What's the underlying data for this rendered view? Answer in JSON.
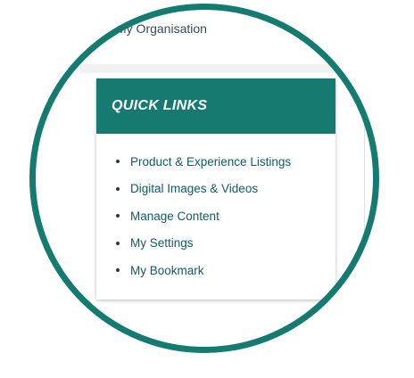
{
  "header": {
    "organisation_label": "My Organisation"
  },
  "quick_links": {
    "title": "QUICK LINKS",
    "items": [
      {
        "label": "Product & Experience Listings"
      },
      {
        "label": "Digital Images & Videos"
      },
      {
        "label": "Manage Content"
      },
      {
        "label": "My Settings"
      },
      {
        "label": "My Bookmark"
      }
    ]
  },
  "colors": {
    "accent": "#177a71",
    "ring": "#147b70",
    "link": "#0f5b66"
  }
}
